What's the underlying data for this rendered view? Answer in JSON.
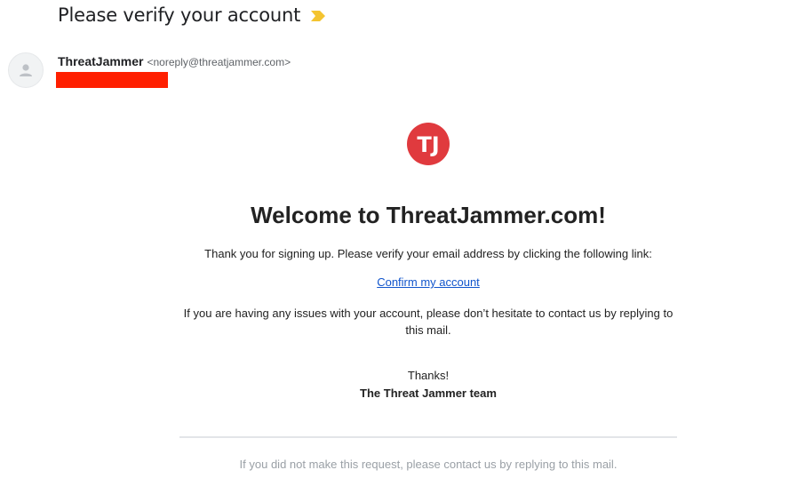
{
  "email": {
    "subject": "Please verify your account",
    "importance_icon": "importance-marker-icon",
    "importance_color": "#f4b400",
    "sender": {
      "name": "ThreatJammer",
      "email": "<noreply@threatjammer.com>"
    },
    "redaction_color": "#ff1f00"
  },
  "body": {
    "logo_text": "TJ",
    "logo_color": "#e03a3e",
    "headline": "Welcome to ThreatJammer.com!",
    "intro": "Thank you for signing up. Please verify your email address by clicking the following link:",
    "confirm_link": "Confirm my account",
    "issues_text": "If you are having any issues with your account, please don’t hesitate to contact us by replying to this mail.",
    "thanks": "Thanks!",
    "signature": "The Threat Jammer team",
    "footer": "If you did not make this request, please contact us by replying to this mail."
  }
}
